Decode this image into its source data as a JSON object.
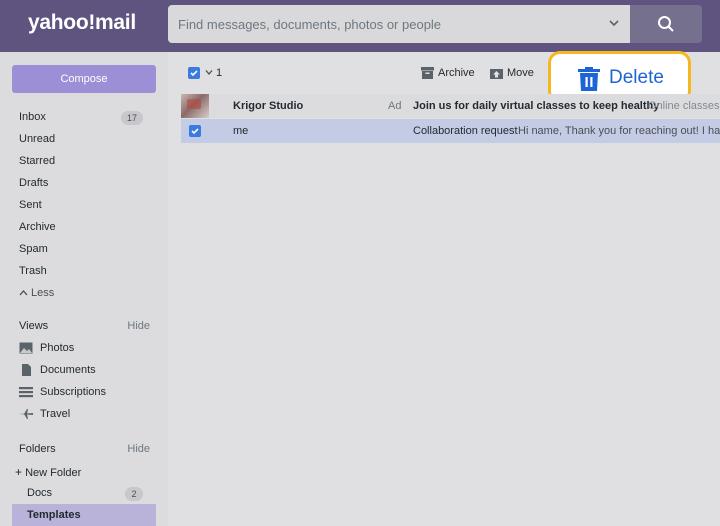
{
  "header": {
    "logo": "yahoo!mail",
    "search_placeholder": "Find messages, documents, photos or people"
  },
  "sidebar": {
    "compose_label": "Compose",
    "items": [
      {
        "label": "Inbox",
        "count": "17"
      },
      {
        "label": "Unread"
      },
      {
        "label": "Starred"
      },
      {
        "label": "Drafts"
      },
      {
        "label": "Sent"
      },
      {
        "label": "Archive"
      },
      {
        "label": "Spam"
      },
      {
        "label": "Trash"
      }
    ],
    "less_label": "Less",
    "views": {
      "title": "Views",
      "hide_label": "Hide",
      "items": [
        "Photos",
        "Documents",
        "Subscriptions",
        "Travel"
      ]
    },
    "folders": {
      "title": "Folders",
      "hide_label": "Hide",
      "new_folder_label": "New Folder",
      "items": [
        {
          "label": "Docs",
          "count": "2"
        },
        {
          "label": "Templates"
        }
      ]
    }
  },
  "toolbar": {
    "selected_count": "1",
    "archive_label": "Archive",
    "move_label": "Move",
    "delete_label": "Delete"
  },
  "messages": [
    {
      "sender": "Krigor Studio",
      "tag": "Ad",
      "subject": "Join us for daily virtual classes to keep healthy",
      "snippet": "Online classes d"
    },
    {
      "sender": "me",
      "subject": "Collaboration request",
      "snippet": "Hi name, Thank you for reaching out! I have"
    }
  ],
  "colors": {
    "header_bg": "#5f5380",
    "compose_bg": "#9d8fd6",
    "accent_blue": "#1d64d6",
    "highlight_border": "#f6b81e"
  }
}
